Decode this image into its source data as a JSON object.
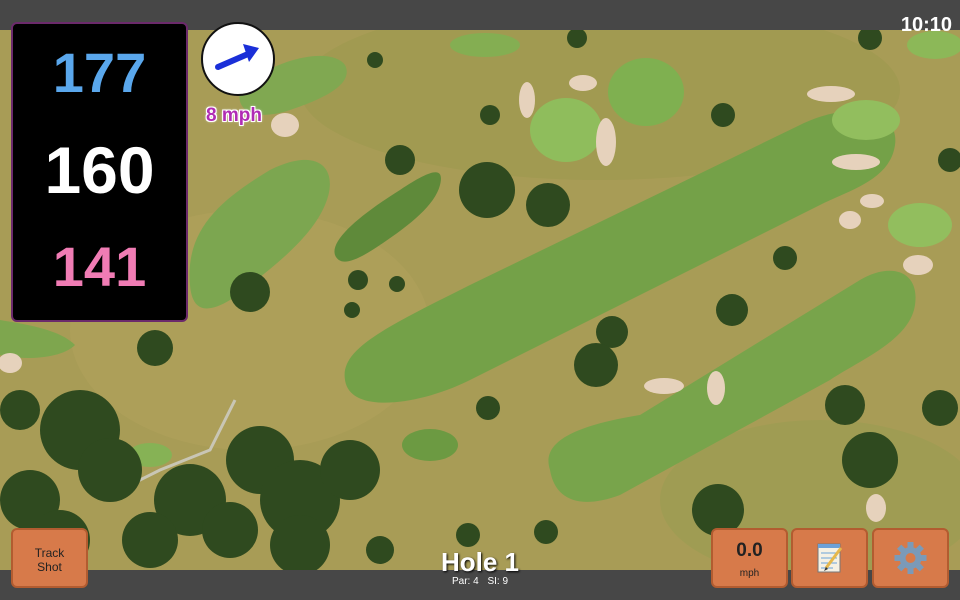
{
  "status_bar": {
    "time": "10:10"
  },
  "distances": {
    "back": "177",
    "middle": "160",
    "front": "141"
  },
  "wind": {
    "speed_label": "8 mph",
    "arrow_icon": "wind-direction-arrow-icon"
  },
  "hole": {
    "title": "Hole 1",
    "par_label": "Par: 4",
    "si_label": "SI: 9"
  },
  "buttons": {
    "track_shot_line1": "Track",
    "track_shot_line2": "Shot",
    "speed_value": "0.0",
    "speed_unit": "mph",
    "notes_icon": "notepad-icon",
    "settings_icon": "gear-icon"
  },
  "colors": {
    "back_distance": "#5aa7ec",
    "middle_distance": "#ffffff",
    "front_distance": "#f07cb4",
    "wind_label": "#b02cb4",
    "button_bg": "#d77a4a"
  }
}
